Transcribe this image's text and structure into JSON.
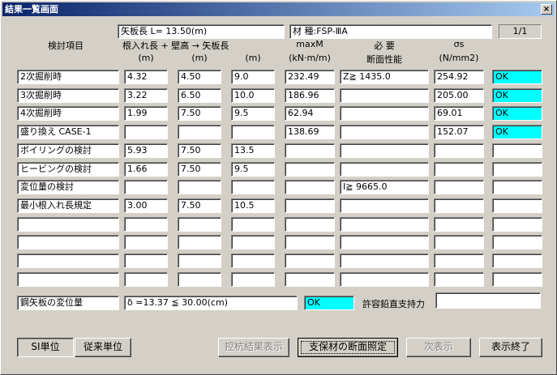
{
  "window": {
    "title": "結果一覧画面",
    "close": "×"
  },
  "header": {
    "length_text": "矢板長 L= 13.50(m)",
    "material_text": "材 種:FSP-ⅢA",
    "page": "1/1"
  },
  "columns": {
    "item": "検討項目",
    "top_line": "根入れ長 + 壁高 → 矢板長",
    "unit_m1": "(m)",
    "unit_m2": "(m)",
    "unit_m3": "(m)",
    "maxm": "maxM",
    "maxm_unit": "(kN·m/m)",
    "req_1": "必 要",
    "req_2": "断面性能",
    "sigma": "σs",
    "sigma_unit": "(N/mm2)"
  },
  "rows": [
    {
      "item": "2次掘削時",
      "embed": "4.32",
      "wall": "4.50",
      "pile": "9.0",
      "maxm": "232.49",
      "req": "Z≧ 1435.0",
      "sigma": "254.92",
      "ok": "OK"
    },
    {
      "item": "3次掘削時",
      "embed": "3.22",
      "wall": "6.50",
      "pile": "10.0",
      "maxm": "186.96",
      "req": "",
      "sigma": "205.00",
      "ok": "OK"
    },
    {
      "item": "4次掘削時",
      "embed": "1.99",
      "wall": "7.50",
      "pile": "9.5",
      "maxm": "62.94",
      "req": "",
      "sigma": "69.01",
      "ok": "OK"
    },
    {
      "item": "盛り換え CASE-1",
      "embed": "",
      "wall": "",
      "pile": "",
      "maxm": "138.69",
      "req": "",
      "sigma": "152.07",
      "ok": "OK"
    },
    {
      "item": "ボイリングの検討",
      "embed": "5.93",
      "wall": "7.50",
      "pile": "13.5",
      "maxm": "",
      "req": "",
      "sigma": "",
      "ok": ""
    },
    {
      "item": "ヒービングの検討",
      "embed": "1.66",
      "wall": "7.50",
      "pile": "9.5",
      "maxm": "",
      "req": "",
      "sigma": "",
      "ok": ""
    },
    {
      "item": "変位量の検討",
      "embed": "",
      "wall": "",
      "pile": "",
      "maxm": "",
      "req": "I≧ 9665.0",
      "sigma": "",
      "ok": ""
    },
    {
      "item": "最小根入れ長規定",
      "embed": "3.00",
      "wall": "7.50",
      "pile": "10.5",
      "maxm": "",
      "req": "",
      "sigma": "",
      "ok": ""
    },
    {
      "item": "",
      "embed": "",
      "wall": "",
      "pile": "",
      "maxm": "",
      "req": "",
      "sigma": "",
      "ok": ""
    },
    {
      "item": "",
      "embed": "",
      "wall": "",
      "pile": "",
      "maxm": "",
      "req": "",
      "sigma": "",
      "ok": ""
    },
    {
      "item": "",
      "embed": "",
      "wall": "",
      "pile": "",
      "maxm": "",
      "req": "",
      "sigma": "",
      "ok": ""
    },
    {
      "item": "",
      "embed": "",
      "wall": "",
      "pile": "",
      "maxm": "",
      "req": "",
      "sigma": "",
      "ok": ""
    }
  ],
  "displacement": {
    "label": "鋼矢板の変位量",
    "value": "δ =13.37 ≦ 30.00(cm)",
    "ok": "OK",
    "vertical_label": "許容鉛直支持力",
    "vertical_value": ""
  },
  "buttons": {
    "si": "SI単位",
    "conventional": "従来単位",
    "pile_result": "控杭結果表示",
    "support_section": "支保材の断面照定",
    "next": "次表示",
    "exit": "表示終了"
  },
  "colors": {
    "ok": "#00ffff",
    "title_start": "#0a246a",
    "title_end": "#a6caf0"
  }
}
